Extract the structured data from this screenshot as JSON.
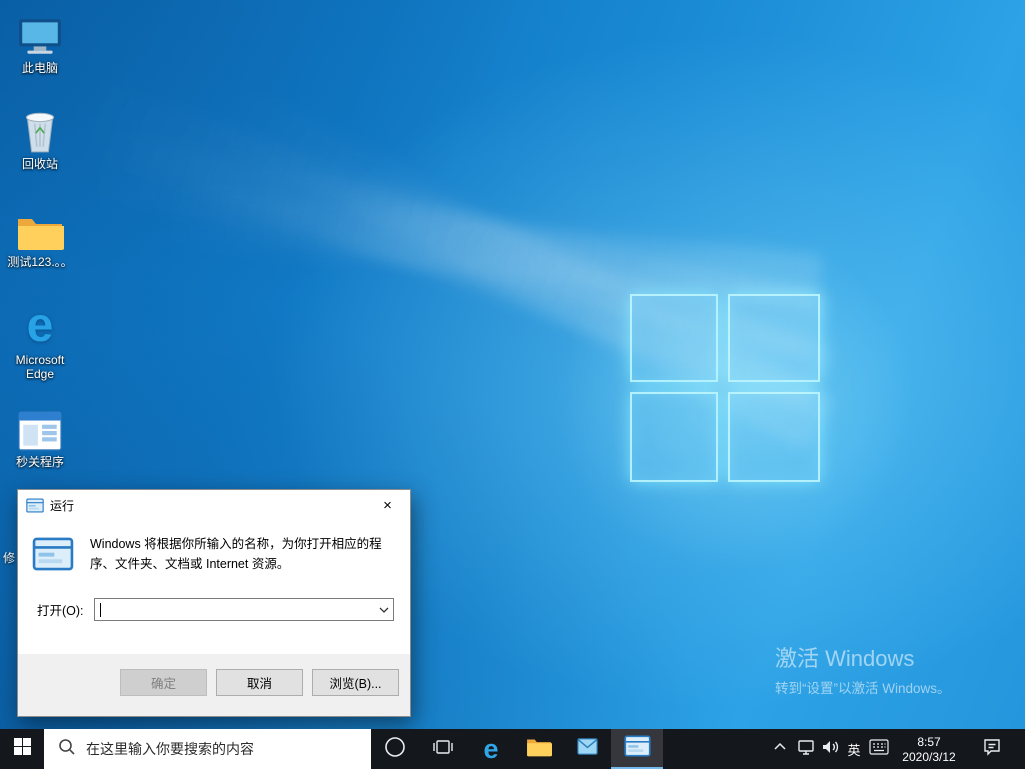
{
  "desktop": {
    "icons": [
      {
        "label": "此电脑"
      },
      {
        "label": "回收站"
      },
      {
        "label": "测试123.。。"
      },
      {
        "label": "Microsoft Edge"
      },
      {
        "label": "秒关程序"
      },
      {
        "label": "修"
      }
    ],
    "watermark": {
      "title": "激活 Windows",
      "subtitle": "转到“设置”以激活 Windows。"
    }
  },
  "run_dialog": {
    "title": "运行",
    "close_glyph": "×",
    "description": "Windows 将根据你所输入的名称，为你打开相应的程序、文件夹、文档或 Internet 资源。",
    "open_label": "打开(O):",
    "input_value": "",
    "ok": "确定",
    "cancel": "取消",
    "browse": "浏览(B)..."
  },
  "taskbar": {
    "search_placeholder": "在这里输入你要搜索的内容",
    "language": "英",
    "time": "8:57",
    "date": "2020/3/12"
  },
  "colors": {
    "accent": "#0078d7",
    "taskbar": "#14171c",
    "active_underline": "#76b9ed"
  }
}
